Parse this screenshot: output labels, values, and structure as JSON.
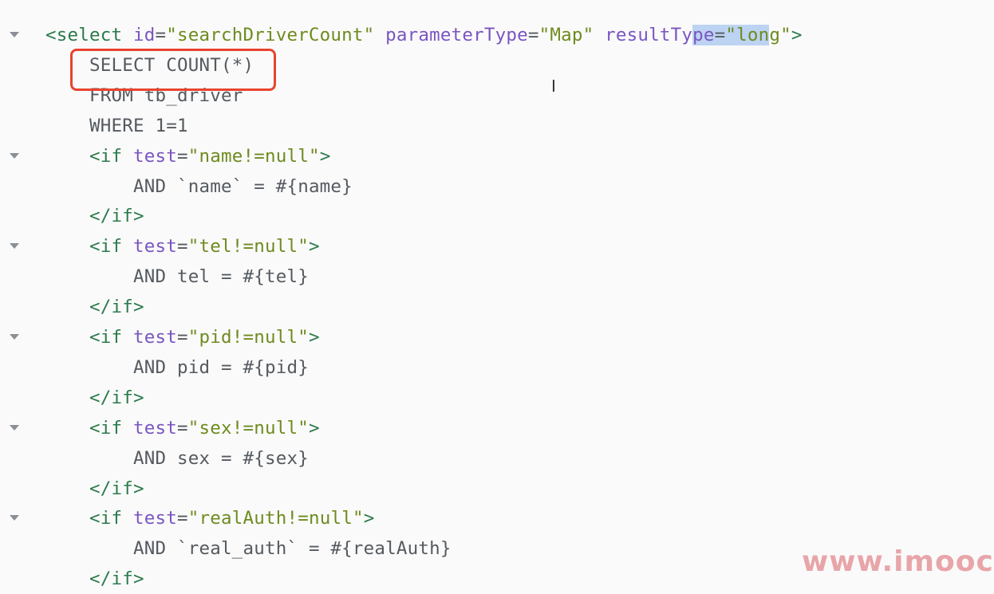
{
  "editor": {
    "lines": [
      {
        "indent": 0,
        "fold": true,
        "tokens": [
          [
            "tag",
            "<select "
          ],
          [
            "attr",
            "id"
          ],
          [
            "text",
            "="
          ],
          [
            "str",
            "\"searchDriverCount\""
          ],
          [
            "text",
            " "
          ],
          [
            "attr",
            "parameterType"
          ],
          [
            "text",
            "="
          ],
          [
            "str",
            "\"Map\""
          ],
          [
            "text",
            " "
          ],
          [
            "attr",
            "resultTy"
          ],
          [
            "attr sel",
            "pe"
          ],
          [
            "text sel",
            "="
          ],
          [
            "str sel",
            "\"lon"
          ],
          [
            "str",
            "g\""
          ],
          [
            "tag",
            ">"
          ]
        ]
      },
      {
        "indent": 4,
        "fold": false,
        "tokens": [
          [
            "text",
            "SELECT COUNT(*)"
          ]
        ]
      },
      {
        "indent": 4,
        "fold": false,
        "tokens": [
          [
            "text",
            "FROM tb_driver"
          ]
        ]
      },
      {
        "indent": 4,
        "fold": false,
        "tokens": [
          [
            "text",
            "WHERE 1=1"
          ]
        ]
      },
      {
        "indent": 4,
        "fold": true,
        "tokens": [
          [
            "tag",
            "<if "
          ],
          [
            "attr",
            "test"
          ],
          [
            "text",
            "="
          ],
          [
            "str",
            "\"name!=null\""
          ],
          [
            "tag",
            ">"
          ]
        ]
      },
      {
        "indent": 8,
        "fold": false,
        "tokens": [
          [
            "text",
            "AND `name` = #{name}"
          ]
        ]
      },
      {
        "indent": 4,
        "fold": false,
        "tokens": [
          [
            "tag",
            "</if>"
          ]
        ]
      },
      {
        "indent": 4,
        "fold": true,
        "tokens": [
          [
            "tag",
            "<if "
          ],
          [
            "attr",
            "test"
          ],
          [
            "text",
            "="
          ],
          [
            "str",
            "\"tel!=null\""
          ],
          [
            "tag",
            ">"
          ]
        ]
      },
      {
        "indent": 8,
        "fold": false,
        "tokens": [
          [
            "text",
            "AND tel = #{tel}"
          ]
        ]
      },
      {
        "indent": 4,
        "fold": false,
        "tokens": [
          [
            "tag",
            "</if>"
          ]
        ]
      },
      {
        "indent": 4,
        "fold": true,
        "tokens": [
          [
            "tag",
            "<if "
          ],
          [
            "attr",
            "test"
          ],
          [
            "text",
            "="
          ],
          [
            "str",
            "\"pid!=null\""
          ],
          [
            "tag",
            ">"
          ]
        ]
      },
      {
        "indent": 8,
        "fold": false,
        "tokens": [
          [
            "text",
            "AND pid = #{pid}"
          ]
        ]
      },
      {
        "indent": 4,
        "fold": false,
        "tokens": [
          [
            "tag",
            "</if>"
          ]
        ]
      },
      {
        "indent": 4,
        "fold": true,
        "tokens": [
          [
            "tag",
            "<if "
          ],
          [
            "attr",
            "test"
          ],
          [
            "text",
            "="
          ],
          [
            "str",
            "\"sex!=null\""
          ],
          [
            "tag",
            ">"
          ]
        ]
      },
      {
        "indent": 8,
        "fold": false,
        "tokens": [
          [
            "text",
            "AND sex = #{sex}"
          ]
        ]
      },
      {
        "indent": 4,
        "fold": false,
        "tokens": [
          [
            "tag",
            "</if>"
          ]
        ]
      },
      {
        "indent": 4,
        "fold": true,
        "tokens": [
          [
            "tag",
            "<if "
          ],
          [
            "attr",
            "test"
          ],
          [
            "text",
            "="
          ],
          [
            "str",
            "\"realAuth!=null\""
          ],
          [
            "tag",
            ">"
          ]
        ]
      },
      {
        "indent": 8,
        "fold": false,
        "tokens": [
          [
            "text",
            "AND `real_auth` = #{realAuth}"
          ]
        ]
      },
      {
        "indent": 4,
        "fold": false,
        "tokens": [
          [
            "tag",
            "</if>"
          ]
        ]
      }
    ],
    "colors": {
      "tag": "#2b7a4b",
      "attr": "#7a55c0",
      "string": "#6e8b1f",
      "text": "#555a60",
      "highlight": "#e8442e"
    }
  },
  "watermark": "www.imooc.c",
  "cursor_icon": "text-cursor-ibeam"
}
